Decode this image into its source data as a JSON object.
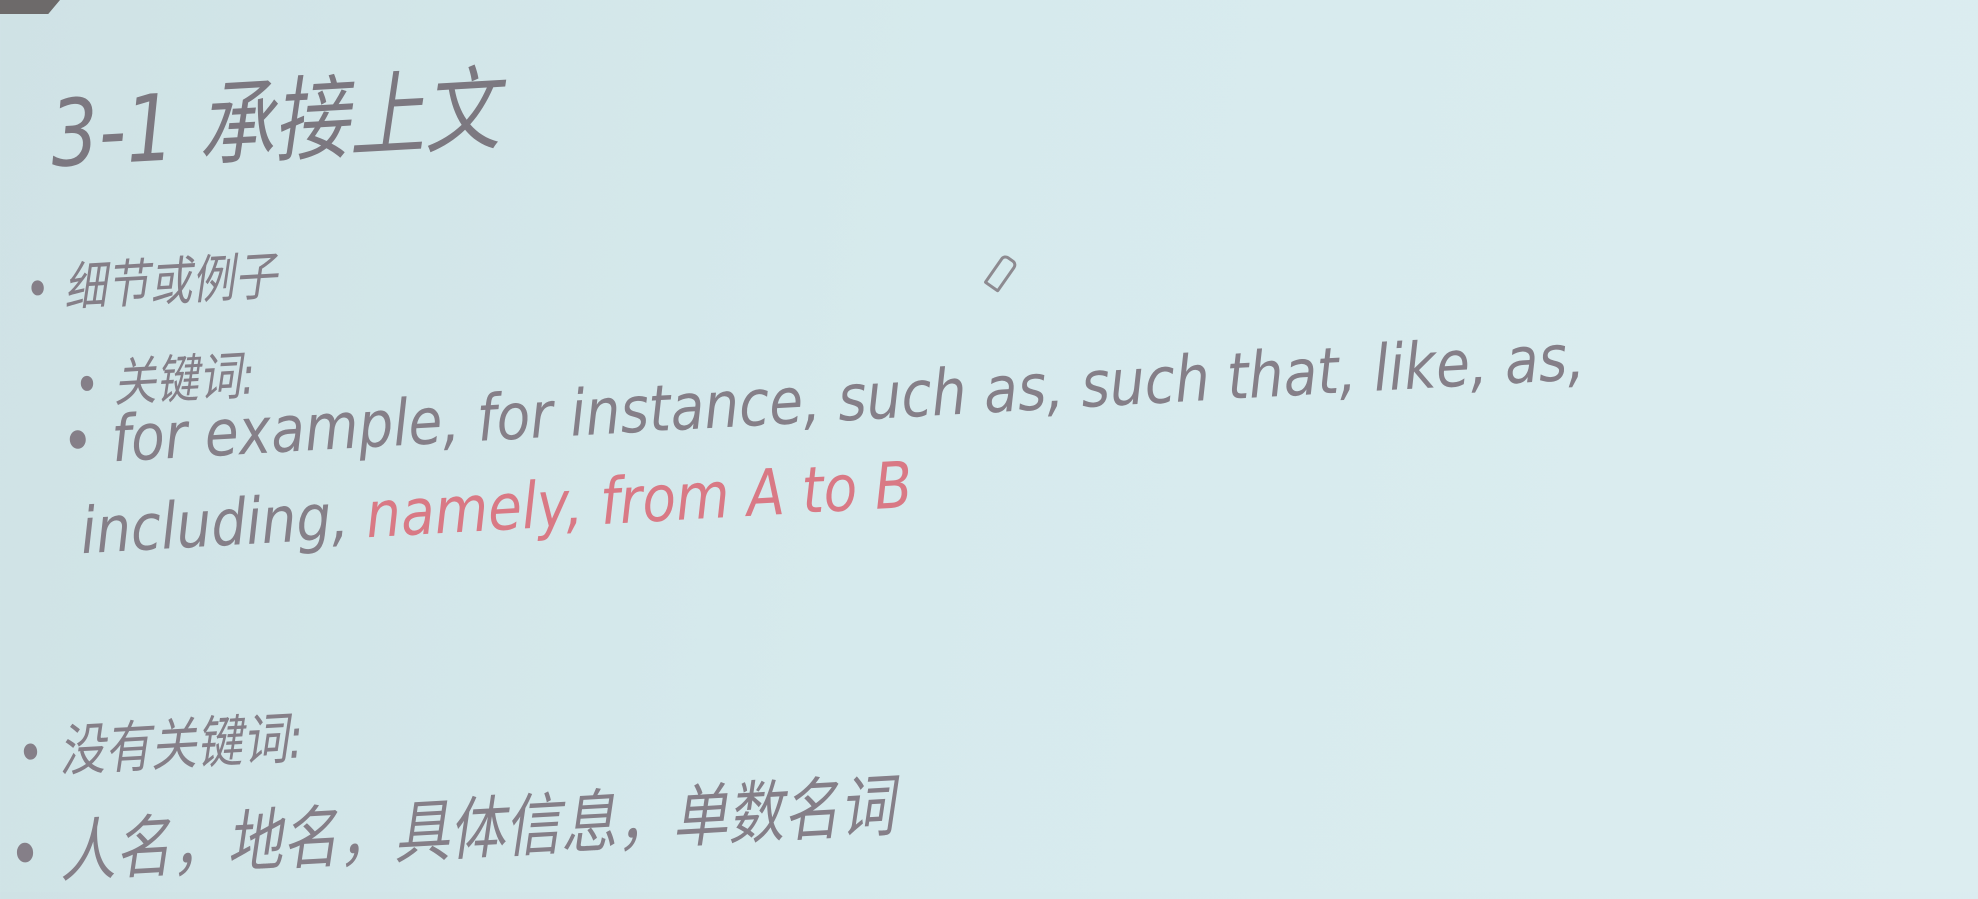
{
  "slide": {
    "title": "3-1 承接上文",
    "bullet_detail": "• 细节或例子",
    "bullet_keywords": "• 关键词:",
    "keywords_line1": "• for example, for instance, such as, such that, like, as,",
    "keywords_line2_gray": "including, ",
    "keywords_line2_red": "namely, from A to B",
    "bullet_no_keywords": "• 没有关键词:",
    "bullet_info": "• 人名，地名，具体信息，单数名词"
  },
  "colors": {
    "background": "#d6eaed",
    "text": "#857f88",
    "highlight": "#d97985"
  }
}
